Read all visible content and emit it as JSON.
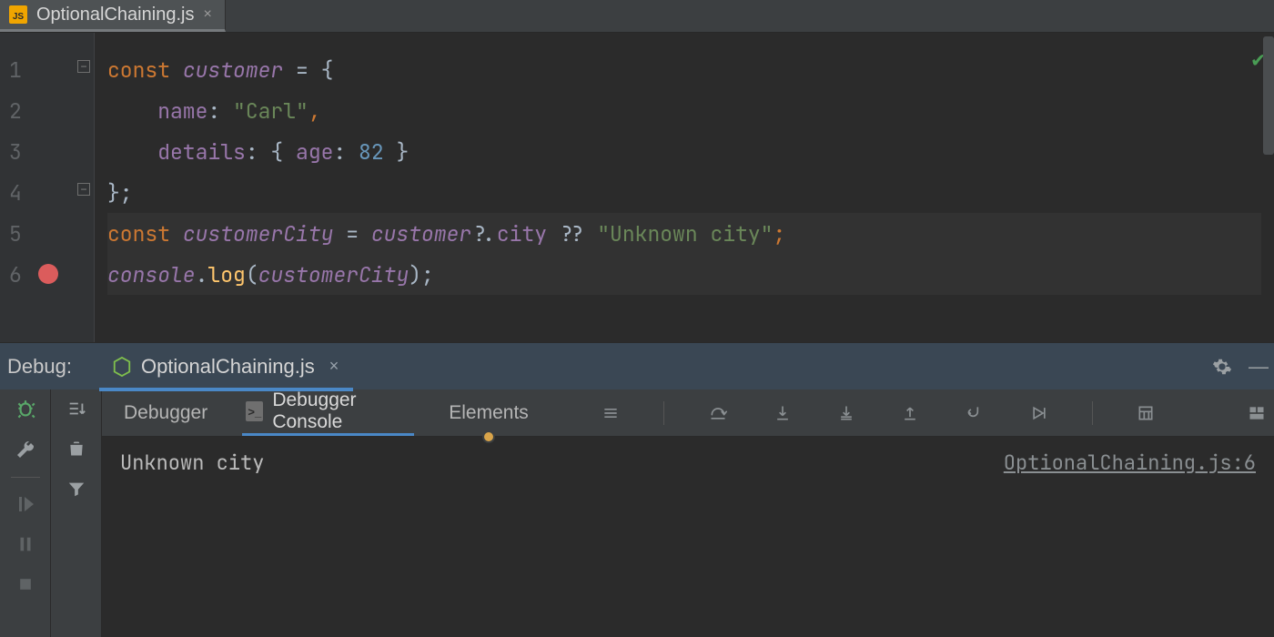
{
  "editor": {
    "tab": {
      "filename": "OptionalChaining.js"
    },
    "lines": [
      "1",
      "2",
      "3",
      "4",
      "5",
      "6"
    ],
    "breakpoint_line": "6",
    "code": {
      "l1": {
        "kw": "const ",
        "id": "customer",
        "rest": " = {"
      },
      "l2": {
        "indent": "    ",
        "prop": "name",
        "colon": ": ",
        "str": "\"Carl\"",
        "comma": ","
      },
      "l3": {
        "indent": "    ",
        "prop": "details",
        "colon": ": { ",
        "prop2": "age",
        "colon2": ": ",
        "num": "82",
        "close": " }"
      },
      "l4": {
        "text": "};"
      },
      "l5": {
        "kw": "const ",
        "id": "customerCity",
        "eq": " = ",
        "id2": "customer",
        "opt": "?.",
        "prop": "city",
        "nn": " ?? ",
        "str": "\"Unknown city\"",
        "semi": ";"
      },
      "l6": {
        "id": "console",
        "dot": ".",
        "fn": "log",
        "open": "(",
        "arg": "customerCity",
        "close": ");"
      }
    }
  },
  "debug": {
    "label": "Debug:",
    "run_config": "OptionalChaining.js",
    "tabs": {
      "debugger": "Debugger",
      "console": "Debugger Console",
      "elements": "Elements"
    },
    "console": {
      "output": "Unknown city",
      "source": "OptionalChaining.js:6"
    }
  }
}
